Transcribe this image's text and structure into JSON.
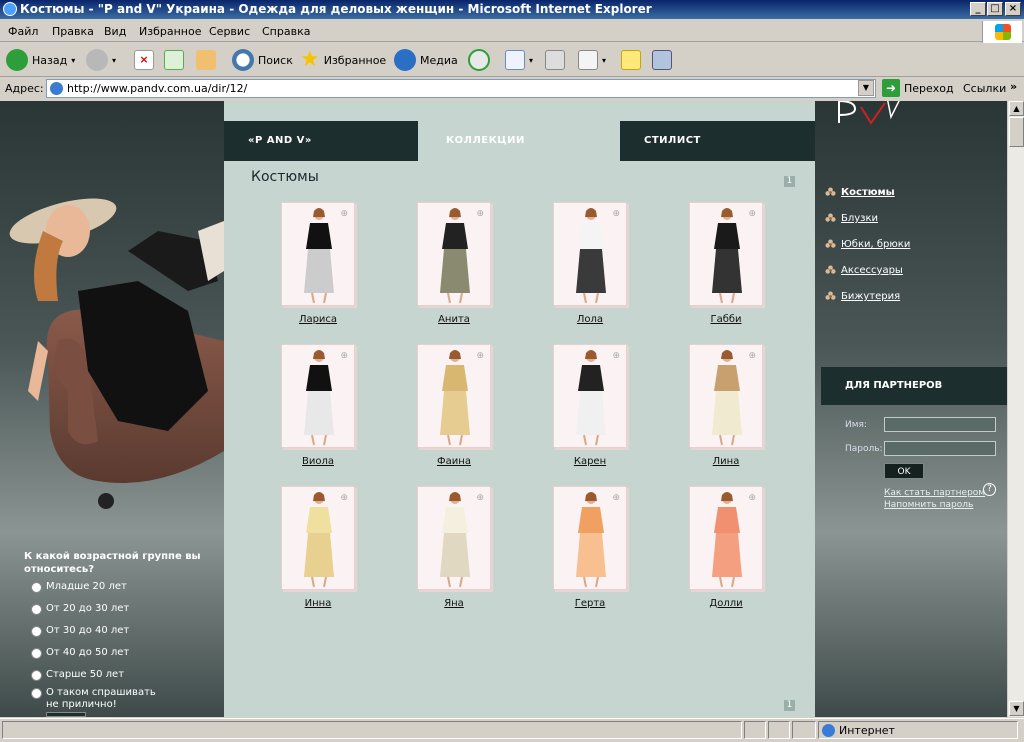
{
  "window": {
    "title": "Костюмы - \"P and V\" Украина - Одежда для деловых женщин - Microsoft Internet Explorer"
  },
  "menu": {
    "items": [
      "Файл",
      "Правка",
      "Вид",
      "Избранное",
      "Сервис",
      "Справка"
    ]
  },
  "toolbar": {
    "back": "Назад",
    "search": "Поиск",
    "favorites": "Избранное",
    "media": "Медиа"
  },
  "address": {
    "label": "Адрес:",
    "url": "http://www.pandv.com.ua/dir/12/",
    "go": "Переход",
    "links": "Ссылки"
  },
  "status": {
    "zone": "Интернет"
  },
  "site": {
    "logo": "P and V",
    "tabs": [
      "«P AND V»",
      "КОЛЛЕКЦИИ",
      "СТИЛИСТ"
    ],
    "active_tab": 1,
    "section_title": "Костюмы",
    "page_number_top": "1",
    "page_number_bottom": "1",
    "products": [
      "Лариса",
      "Анита",
      "Лола",
      "Габби",
      "Виола",
      "Фаина",
      "Карен",
      "Лина",
      "Инна",
      "Яна",
      "Герта",
      "Долли"
    ],
    "categories": [
      "Костюмы",
      "Блузки",
      "Юбки, брюки",
      "Аксессуары",
      "Бижутерия"
    ],
    "selected_category": 0,
    "partners": {
      "title": "ДЛЯ ПАРТНЕРОВ",
      "name_label": "Имя:",
      "password_label": "Пароль:",
      "ok": "OK",
      "become_partner": "Как стать партнером",
      "remind_password": "Напомнить пароль",
      "help": "?"
    },
    "survey": {
      "question": "К какой возрастной группе вы относитесь?",
      "options": [
        "Младше 20 лет",
        "От 20 до 30 лет",
        "От 30 до 40 лет",
        "От 40 до 50 лет",
        "Старше 50 лет",
        "О таком спрашивать не прилично!"
      ]
    }
  },
  "colors": {
    "panel_dark": "#1c2e2d",
    "content_bg": "#c7d5d1",
    "accent_red": "#cc2222"
  }
}
